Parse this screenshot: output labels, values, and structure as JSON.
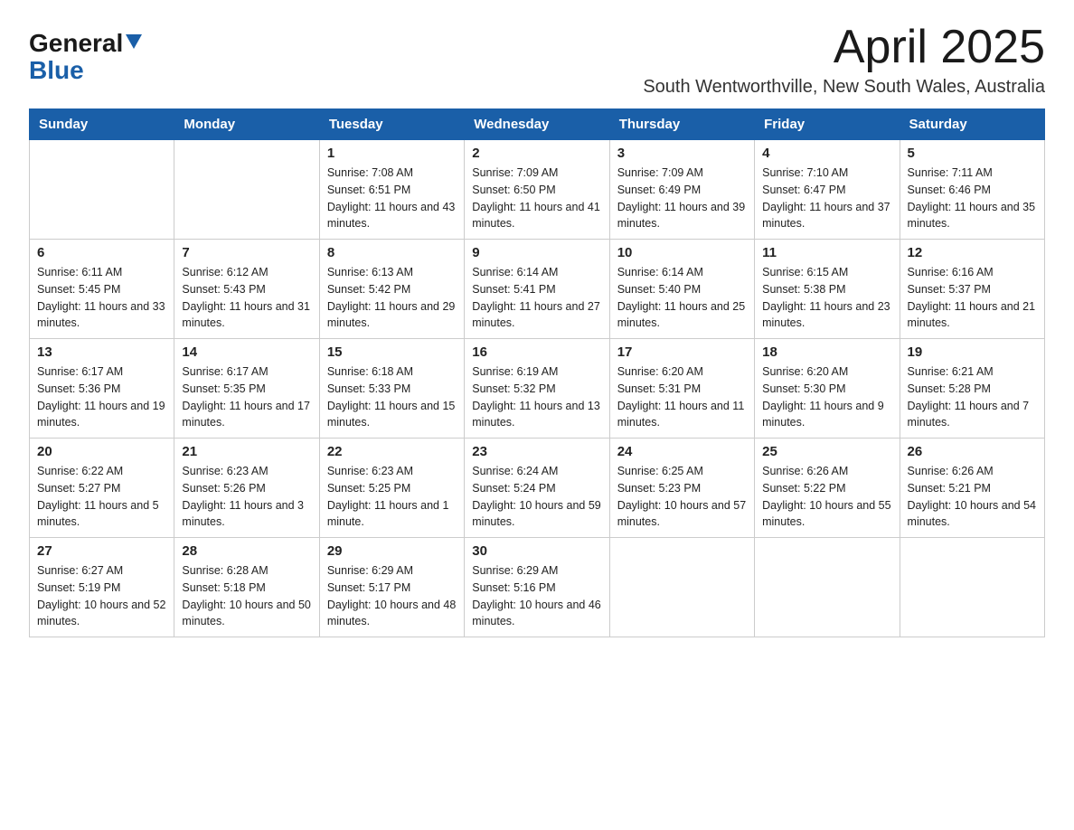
{
  "logo": {
    "general": "General",
    "blue": "Blue"
  },
  "title": "April 2025",
  "location": "South Wentworthville, New South Wales, Australia",
  "weekdays": [
    "Sunday",
    "Monday",
    "Tuesday",
    "Wednesday",
    "Thursday",
    "Friday",
    "Saturday"
  ],
  "weeks": [
    [
      {
        "day": "",
        "sunrise": "",
        "sunset": "",
        "daylight": ""
      },
      {
        "day": "",
        "sunrise": "",
        "sunset": "",
        "daylight": ""
      },
      {
        "day": "1",
        "sunrise": "Sunrise: 7:08 AM",
        "sunset": "Sunset: 6:51 PM",
        "daylight": "Daylight: 11 hours and 43 minutes."
      },
      {
        "day": "2",
        "sunrise": "Sunrise: 7:09 AM",
        "sunset": "Sunset: 6:50 PM",
        "daylight": "Daylight: 11 hours and 41 minutes."
      },
      {
        "day": "3",
        "sunrise": "Sunrise: 7:09 AM",
        "sunset": "Sunset: 6:49 PM",
        "daylight": "Daylight: 11 hours and 39 minutes."
      },
      {
        "day": "4",
        "sunrise": "Sunrise: 7:10 AM",
        "sunset": "Sunset: 6:47 PM",
        "daylight": "Daylight: 11 hours and 37 minutes."
      },
      {
        "day": "5",
        "sunrise": "Sunrise: 7:11 AM",
        "sunset": "Sunset: 6:46 PM",
        "daylight": "Daylight: 11 hours and 35 minutes."
      }
    ],
    [
      {
        "day": "6",
        "sunrise": "Sunrise: 6:11 AM",
        "sunset": "Sunset: 5:45 PM",
        "daylight": "Daylight: 11 hours and 33 minutes."
      },
      {
        "day": "7",
        "sunrise": "Sunrise: 6:12 AM",
        "sunset": "Sunset: 5:43 PM",
        "daylight": "Daylight: 11 hours and 31 minutes."
      },
      {
        "day": "8",
        "sunrise": "Sunrise: 6:13 AM",
        "sunset": "Sunset: 5:42 PM",
        "daylight": "Daylight: 11 hours and 29 minutes."
      },
      {
        "day": "9",
        "sunrise": "Sunrise: 6:14 AM",
        "sunset": "Sunset: 5:41 PM",
        "daylight": "Daylight: 11 hours and 27 minutes."
      },
      {
        "day": "10",
        "sunrise": "Sunrise: 6:14 AM",
        "sunset": "Sunset: 5:40 PM",
        "daylight": "Daylight: 11 hours and 25 minutes."
      },
      {
        "day": "11",
        "sunrise": "Sunrise: 6:15 AM",
        "sunset": "Sunset: 5:38 PM",
        "daylight": "Daylight: 11 hours and 23 minutes."
      },
      {
        "day": "12",
        "sunrise": "Sunrise: 6:16 AM",
        "sunset": "Sunset: 5:37 PM",
        "daylight": "Daylight: 11 hours and 21 minutes."
      }
    ],
    [
      {
        "day": "13",
        "sunrise": "Sunrise: 6:17 AM",
        "sunset": "Sunset: 5:36 PM",
        "daylight": "Daylight: 11 hours and 19 minutes."
      },
      {
        "day": "14",
        "sunrise": "Sunrise: 6:17 AM",
        "sunset": "Sunset: 5:35 PM",
        "daylight": "Daylight: 11 hours and 17 minutes."
      },
      {
        "day": "15",
        "sunrise": "Sunrise: 6:18 AM",
        "sunset": "Sunset: 5:33 PM",
        "daylight": "Daylight: 11 hours and 15 minutes."
      },
      {
        "day": "16",
        "sunrise": "Sunrise: 6:19 AM",
        "sunset": "Sunset: 5:32 PM",
        "daylight": "Daylight: 11 hours and 13 minutes."
      },
      {
        "day": "17",
        "sunrise": "Sunrise: 6:20 AM",
        "sunset": "Sunset: 5:31 PM",
        "daylight": "Daylight: 11 hours and 11 minutes."
      },
      {
        "day": "18",
        "sunrise": "Sunrise: 6:20 AM",
        "sunset": "Sunset: 5:30 PM",
        "daylight": "Daylight: 11 hours and 9 minutes."
      },
      {
        "day": "19",
        "sunrise": "Sunrise: 6:21 AM",
        "sunset": "Sunset: 5:28 PM",
        "daylight": "Daylight: 11 hours and 7 minutes."
      }
    ],
    [
      {
        "day": "20",
        "sunrise": "Sunrise: 6:22 AM",
        "sunset": "Sunset: 5:27 PM",
        "daylight": "Daylight: 11 hours and 5 minutes."
      },
      {
        "day": "21",
        "sunrise": "Sunrise: 6:23 AM",
        "sunset": "Sunset: 5:26 PM",
        "daylight": "Daylight: 11 hours and 3 minutes."
      },
      {
        "day": "22",
        "sunrise": "Sunrise: 6:23 AM",
        "sunset": "Sunset: 5:25 PM",
        "daylight": "Daylight: 11 hours and 1 minute."
      },
      {
        "day": "23",
        "sunrise": "Sunrise: 6:24 AM",
        "sunset": "Sunset: 5:24 PM",
        "daylight": "Daylight: 10 hours and 59 minutes."
      },
      {
        "day": "24",
        "sunrise": "Sunrise: 6:25 AM",
        "sunset": "Sunset: 5:23 PM",
        "daylight": "Daylight: 10 hours and 57 minutes."
      },
      {
        "day": "25",
        "sunrise": "Sunrise: 6:26 AM",
        "sunset": "Sunset: 5:22 PM",
        "daylight": "Daylight: 10 hours and 55 minutes."
      },
      {
        "day": "26",
        "sunrise": "Sunrise: 6:26 AM",
        "sunset": "Sunset: 5:21 PM",
        "daylight": "Daylight: 10 hours and 54 minutes."
      }
    ],
    [
      {
        "day": "27",
        "sunrise": "Sunrise: 6:27 AM",
        "sunset": "Sunset: 5:19 PM",
        "daylight": "Daylight: 10 hours and 52 minutes."
      },
      {
        "day": "28",
        "sunrise": "Sunrise: 6:28 AM",
        "sunset": "Sunset: 5:18 PM",
        "daylight": "Daylight: 10 hours and 50 minutes."
      },
      {
        "day": "29",
        "sunrise": "Sunrise: 6:29 AM",
        "sunset": "Sunset: 5:17 PM",
        "daylight": "Daylight: 10 hours and 48 minutes."
      },
      {
        "day": "30",
        "sunrise": "Sunrise: 6:29 AM",
        "sunset": "Sunset: 5:16 PM",
        "daylight": "Daylight: 10 hours and 46 minutes."
      },
      {
        "day": "",
        "sunrise": "",
        "sunset": "",
        "daylight": ""
      },
      {
        "day": "",
        "sunrise": "",
        "sunset": "",
        "daylight": ""
      },
      {
        "day": "",
        "sunrise": "",
        "sunset": "",
        "daylight": ""
      }
    ]
  ]
}
